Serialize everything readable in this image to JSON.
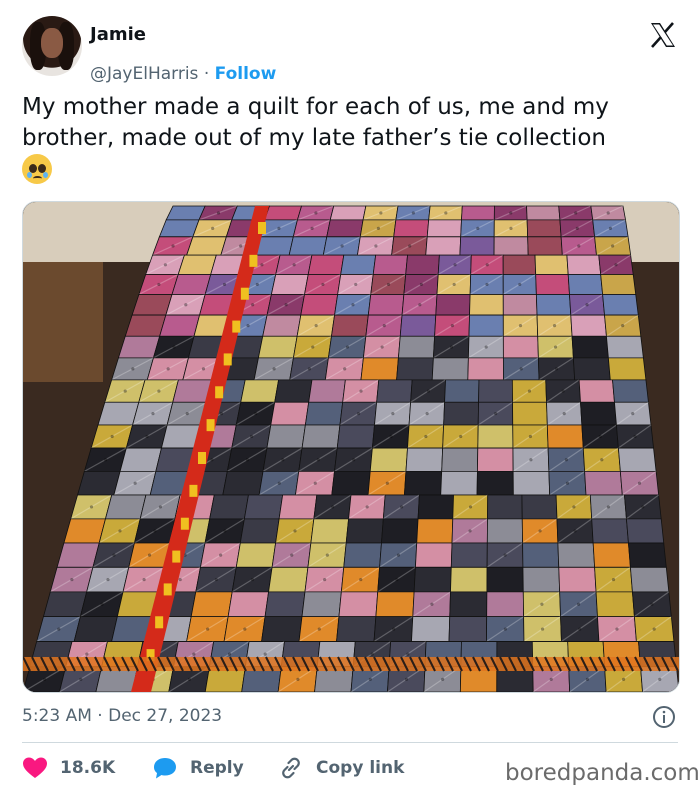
{
  "author": {
    "name": "Jamie",
    "handle": "@JayElHarris",
    "separator": "·",
    "follow_label": "Follow"
  },
  "platform_icon": "x-logo-icon",
  "tweet": {
    "text": "My mother made a quilt for each of us, me and my brother, made out of my late father’s tie collection",
    "emoji": "face-holding-back-tears-emoji"
  },
  "media": {
    "description_icon": "tie-quilt-photo"
  },
  "meta": {
    "time": "5:23 AM",
    "separator": "·",
    "date": "Dec 27, 2023"
  },
  "actions": {
    "like_count": "18.6K",
    "reply_label": "Reply",
    "copy_link_label": "Copy link"
  },
  "watermark": "boredpanda.com",
  "colors": {
    "accent": "#1d9bf0",
    "like": "#f91880",
    "muted": "#536471"
  }
}
